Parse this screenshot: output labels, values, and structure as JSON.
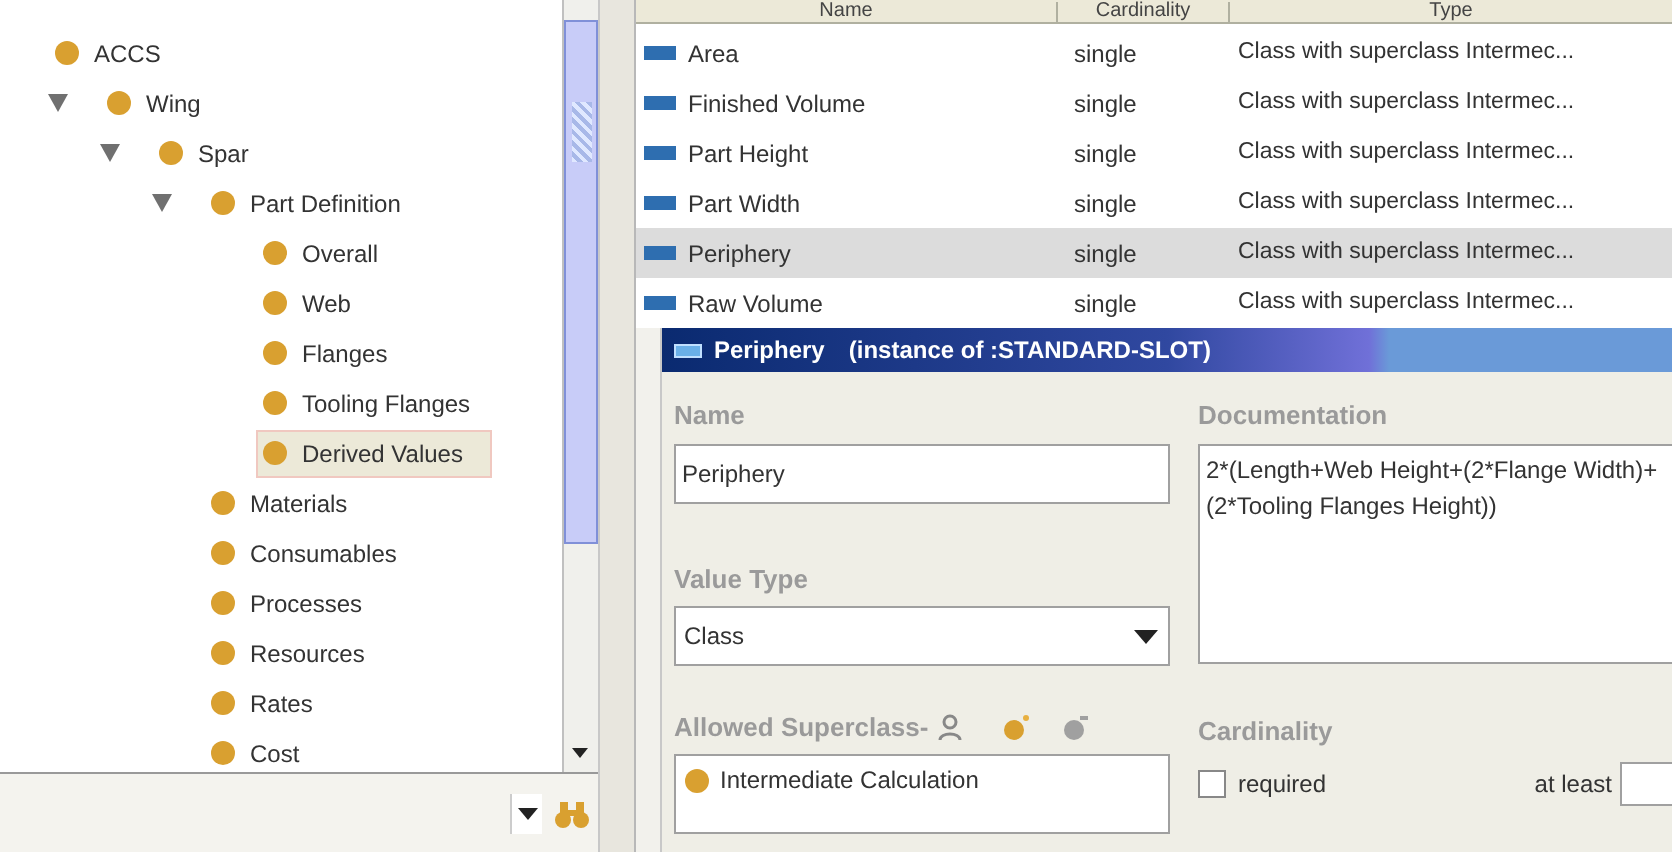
{
  "tree": [
    {
      "label": "ACCS",
      "selected": false,
      "children": [
        {
          "label": "Wing",
          "selected": false,
          "expanded": true,
          "children": [
            {
              "label": "Spar",
              "selected": false,
              "expanded": true,
              "children": [
                {
                  "label": "Part Definition",
                  "selected": false,
                  "expanded": true,
                  "children": [
                    {
                      "label": "Overall",
                      "selected": false
                    },
                    {
                      "label": "Web",
                      "selected": false
                    },
                    {
                      "label": "Flanges",
                      "selected": false
                    },
                    {
                      "label": "Tooling Flanges",
                      "selected": false
                    },
                    {
                      "label": "Derived Values",
                      "selected": true
                    }
                  ]
                },
                {
                  "label": "Materials",
                  "selected": false
                },
                {
                  "label": "Consumables",
                  "selected": false
                },
                {
                  "label": "Processes",
                  "selected": false
                },
                {
                  "label": "Resources",
                  "selected": false
                },
                {
                  "label": "Rates",
                  "selected": false
                },
                {
                  "label": "Cost",
                  "selected": false
                }
              ]
            }
          ]
        }
      ]
    }
  ],
  "table": {
    "columns": [
      "Name",
      "Cardinality",
      "Type"
    ],
    "rows": [
      {
        "name": "Area",
        "cardinality": "single",
        "type": "Class with superclass Intermec...",
        "selected": false
      },
      {
        "name": "Finished Volume",
        "cardinality": "single",
        "type": "Class with superclass Intermec...",
        "selected": false
      },
      {
        "name": "Part Height",
        "cardinality": "single",
        "type": "Class with superclass Intermec...",
        "selected": false
      },
      {
        "name": "Part Width",
        "cardinality": "single",
        "type": "Class with superclass Intermec...",
        "selected": false
      },
      {
        "name": "Periphery",
        "cardinality": "single",
        "type": "Class with superclass Intermec...",
        "selected": true
      },
      {
        "name": "Raw Volume",
        "cardinality": "single",
        "type": "Class with superclass Intermec...",
        "selected": false
      }
    ]
  },
  "form": {
    "title": "Periphery",
    "subtitle": "(instance of :STANDARD-SLOT)",
    "name_label": "Name",
    "name_value": "Periphery",
    "documentation_label": "Documentation",
    "documentation_value": "2*(Length+Web Height+(2*Flange Width)+(2*Tooling Flanges Height))",
    "value_type_label": "Value Type",
    "value_type_value": "Class",
    "superclass_label": "Allowed Superclass-",
    "superclasses": [
      "Intermediate Calculation"
    ],
    "cardinality_label": "Cardinality",
    "required_label": "required",
    "required_checked": false,
    "at_least_label": "at least"
  }
}
